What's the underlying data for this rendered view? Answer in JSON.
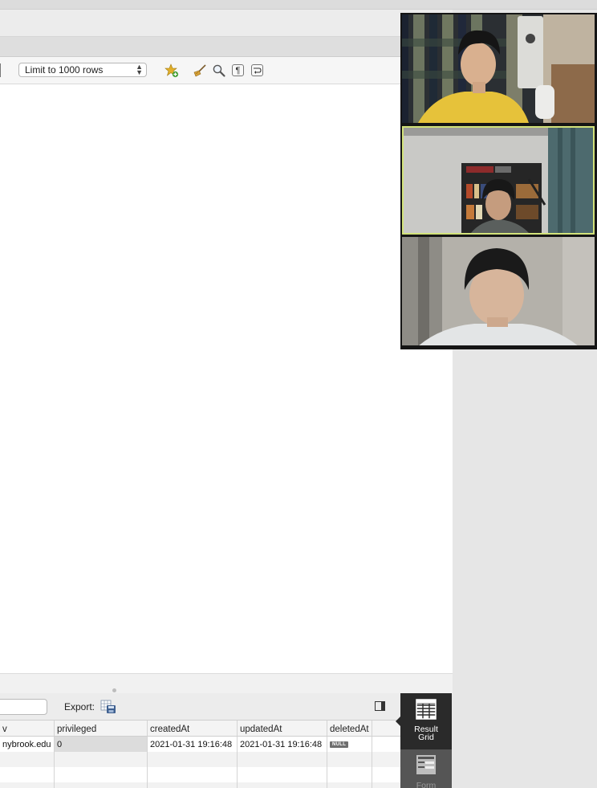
{
  "toolbar": {
    "limit_select": "Limit to 1000 rows"
  },
  "results": {
    "export_label": "Export:",
    "columns": [
      "v",
      "privileged",
      "createdAt",
      "updatedAt",
      "deletedAt"
    ],
    "row": {
      "email_fragment": "nybrook.edu",
      "privileged": "0",
      "createdAt": "2021-01-31 19:16:48",
      "updatedAt": "2021-01-31 19:16:48",
      "deletedAt": "NULL"
    }
  },
  "side_panel": {
    "result_grid_label_1": "Result",
    "result_grid_label_2": "Grid",
    "form_label": "Form"
  },
  "video_call": {
    "participants": 3,
    "active_speaker_index": 1,
    "active_border_color": "#d2e27a"
  },
  "colors": {
    "side_panel_bg": "#2a2a2a",
    "null_badge_bg": "#6f6f6f"
  },
  "icons": [
    "bookmark-star-icon",
    "beautify-broom-icon",
    "find-magnifier-icon",
    "invisible-chars-icon",
    "wrap-lines-icon",
    "export-file-icon",
    "panel-toggle-icon",
    "result-grid-icon",
    "form-editor-icon",
    "chevron-updown-icon"
  ]
}
